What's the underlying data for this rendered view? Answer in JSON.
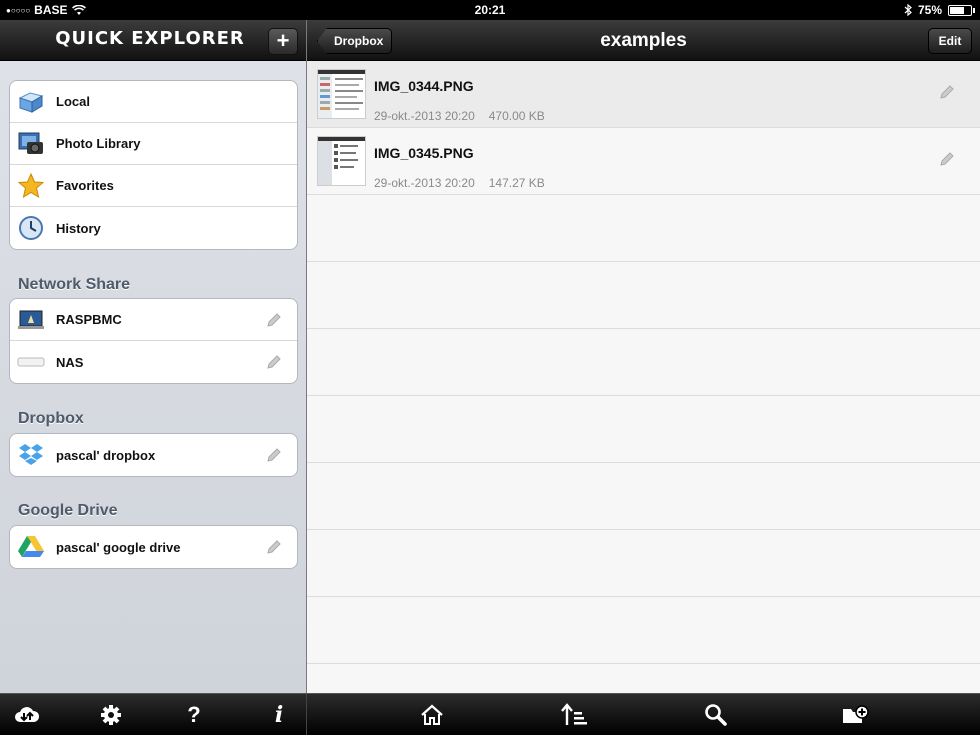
{
  "status_bar": {
    "carrier": "BASE",
    "time": "20:21",
    "battery": "75%",
    "battery_level": 0.75
  },
  "sidebar": {
    "app_title": "QUICK EXPLORER",
    "add_label": "+",
    "locations": [
      {
        "label": "Local",
        "icon": "folder-icon"
      },
      {
        "label": "Photo Library",
        "icon": "photo-library-icon"
      },
      {
        "label": "Favorites",
        "icon": "star-icon"
      },
      {
        "label": "History",
        "icon": "clock-icon"
      }
    ],
    "network_share": {
      "title": "Network Share",
      "items": [
        {
          "label": "RASPBMC",
          "icon": "computer-icon"
        },
        {
          "label": "NAS",
          "icon": "nas-icon"
        }
      ]
    },
    "dropbox": {
      "title": "Dropbox",
      "items": [
        {
          "label": "pascal' dropbox",
          "icon": "dropbox-icon"
        }
      ]
    },
    "google_drive": {
      "title": "Google Drive",
      "items": [
        {
          "label": "pascal' google drive",
          "icon": "google-drive-icon"
        }
      ]
    }
  },
  "main": {
    "back_label": "Dropbox",
    "title": "examples",
    "edit_label": "Edit",
    "files": [
      {
        "name": "IMG_0344.PNG",
        "date": "29-okt.-2013 20:20",
        "size": "470.00 KB"
      },
      {
        "name": "IMG_0345.PNG",
        "date": "29-okt.-2013 20:20",
        "size": "147.27 KB"
      }
    ]
  },
  "toolbar": {
    "left": [
      "cloud-transfer-icon",
      "gear-icon",
      "help-icon",
      "info-icon"
    ],
    "right": [
      "home-icon",
      "sort-icon",
      "search-icon",
      "new-folder-icon"
    ]
  },
  "colors": {
    "section_title": "#4f5a6b",
    "header_bg": "#1e1e1e",
    "selected_row": "#ebebeb"
  }
}
